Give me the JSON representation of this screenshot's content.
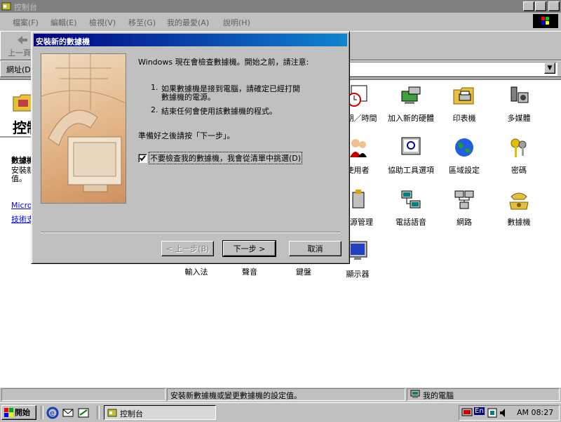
{
  "window": {
    "title": "控制台"
  },
  "menu": [
    "檔案(F)",
    "編輯(E)",
    "檢視(V)",
    "移至(G)",
    "我的最愛(A)",
    "說明(H)"
  ],
  "toolbar": {
    "back_label": "上一頁",
    "address_label": "網址(D)"
  },
  "left_panel": {
    "title": "控制",
    "heading": "數據機",
    "desc_lines": [
      "安裝新",
      "值。"
    ],
    "links": [
      "Micro",
      "技術支"
    ]
  },
  "icons_row1": [
    {
      "label": "日期／時間",
      "icon": "clock-calendar-icon"
    },
    {
      "label": "加入新的硬體",
      "icon": "add-hardware-icon"
    },
    {
      "label": "印表機",
      "icon": "printer-folder-icon"
    },
    {
      "label": "多媒體",
      "icon": "multimedia-icon"
    }
  ],
  "icons_row2": [
    {
      "label": "使用者",
      "icon": "users-icon"
    },
    {
      "label": "協助工具選項",
      "icon": "accessibility-icon"
    },
    {
      "label": "區域設定",
      "icon": "globe-icon"
    },
    {
      "label": "密碼",
      "icon": "keys-icon"
    }
  ],
  "icons_row3": [
    {
      "label": "電源管理",
      "icon": "power-icon"
    },
    {
      "label": "電話語音",
      "icon": "telephony-icon"
    },
    {
      "label": "網路",
      "icon": "network-icon"
    },
    {
      "label": "數據機",
      "icon": "modem-phone-icon"
    }
  ],
  "icons_row4": [
    {
      "label": "輸入法",
      "icon": ""
    },
    {
      "label": "聲音",
      "icon": ""
    },
    {
      "label": "鍵盤",
      "icon": ""
    },
    {
      "label": "顯示器",
      "icon": "display-icon"
    }
  ],
  "dialog": {
    "title": "安裝新的數據機",
    "intro": "Windows 現在會檢查數據機。開始之前，請注意:",
    "step1_num": "1.",
    "step1_line1": "如果數據機是接到電腦，請確定已經打開",
    "step1_line2": "數據機的電源。",
    "step2_num": "2.",
    "step2_line1": "結束任何會使用該數據機的程式。",
    "prompt": "準備好之後請按「下一步」。",
    "checkbox_label": "不要檢查我的數據機，我會從清單中挑選(D)",
    "checkbox_checked": true,
    "back_button": "< 上一步(B)",
    "next_button": "下一步 >",
    "cancel_button": "取消"
  },
  "status": {
    "text": "安裝新數據機或變更數據機的設定值。",
    "zone": "我的電腦"
  },
  "taskbar": {
    "start": "開始",
    "task": "控制台",
    "clock": "AM 08:27",
    "lang": "En"
  }
}
